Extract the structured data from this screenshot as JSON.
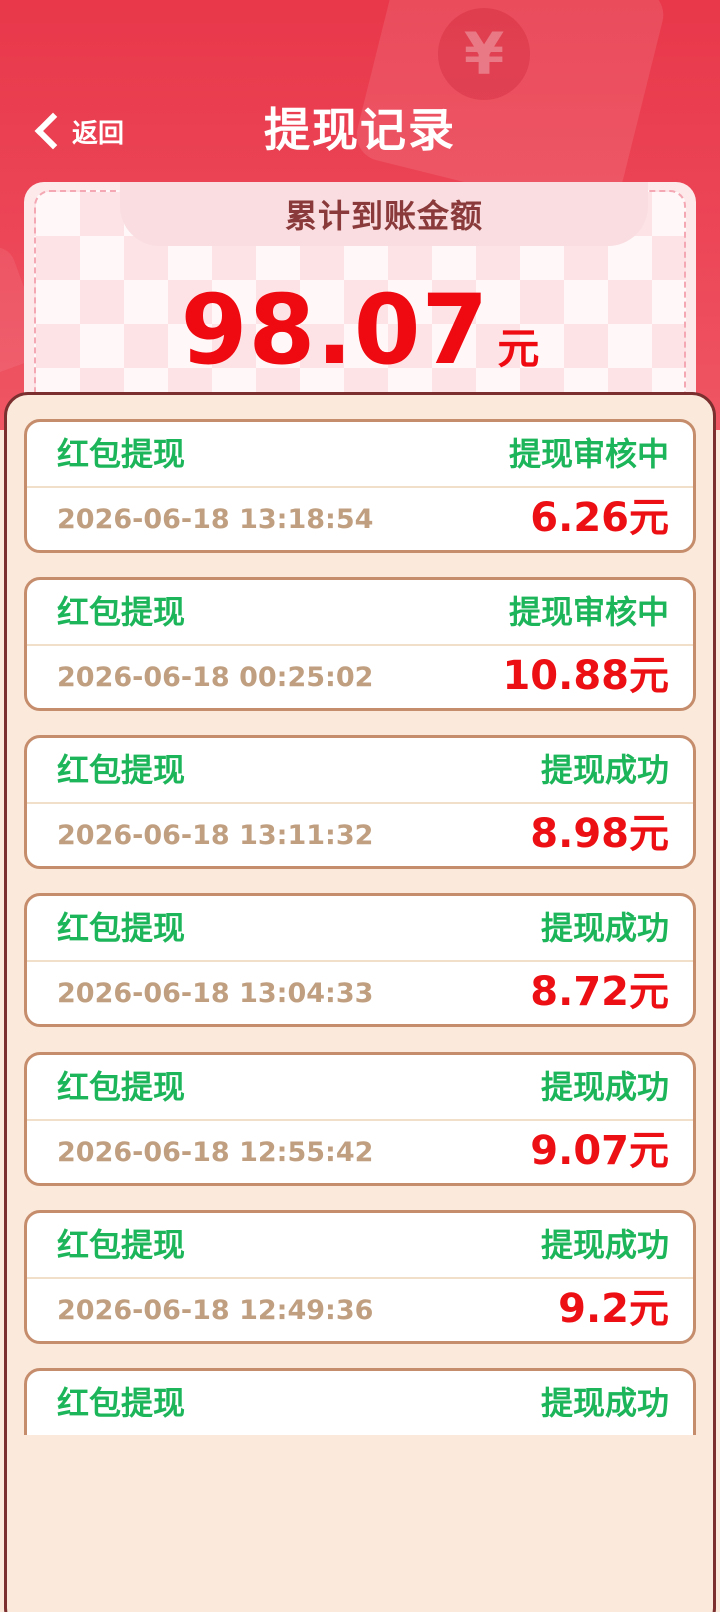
{
  "header": {
    "back_label": "返回",
    "title": "提现记录"
  },
  "summary": {
    "label": "累计到账金额",
    "amount": "98.07",
    "unit": "元",
    "coin_symbol": "¥"
  },
  "records": [
    {
      "type": "红包提现",
      "status": "提现审核中",
      "time": "2026-06-18 13:18:54",
      "amount": "6.26元"
    },
    {
      "type": "红包提现",
      "status": "提现审核中",
      "time": "2026-06-18 00:25:02",
      "amount": "10.88元"
    },
    {
      "type": "红包提现",
      "status": "提现成功",
      "time": "2026-06-18 13:11:32",
      "amount": "8.98元"
    },
    {
      "type": "红包提现",
      "status": "提现成功",
      "time": "2026-06-18 13:04:33",
      "amount": "8.72元"
    },
    {
      "type": "红包提现",
      "status": "提现成功",
      "time": "2026-06-18 12:55:42",
      "amount": "9.07元"
    },
    {
      "type": "红包提现",
      "status": "提现成功",
      "time": "2026-06-18 12:49:36",
      "amount": "9.2元"
    },
    {
      "type": "红包提现",
      "status": "提现成功",
      "time": "",
      "amount": ""
    }
  ],
  "colors": {
    "header_red": "#e8384a",
    "amount_red": "#ee0a10",
    "status_green": "#1db55a",
    "timestamp_tan": "#c09f80",
    "card_border": "#c68d6d",
    "panel_bg": "#fbeadb"
  }
}
